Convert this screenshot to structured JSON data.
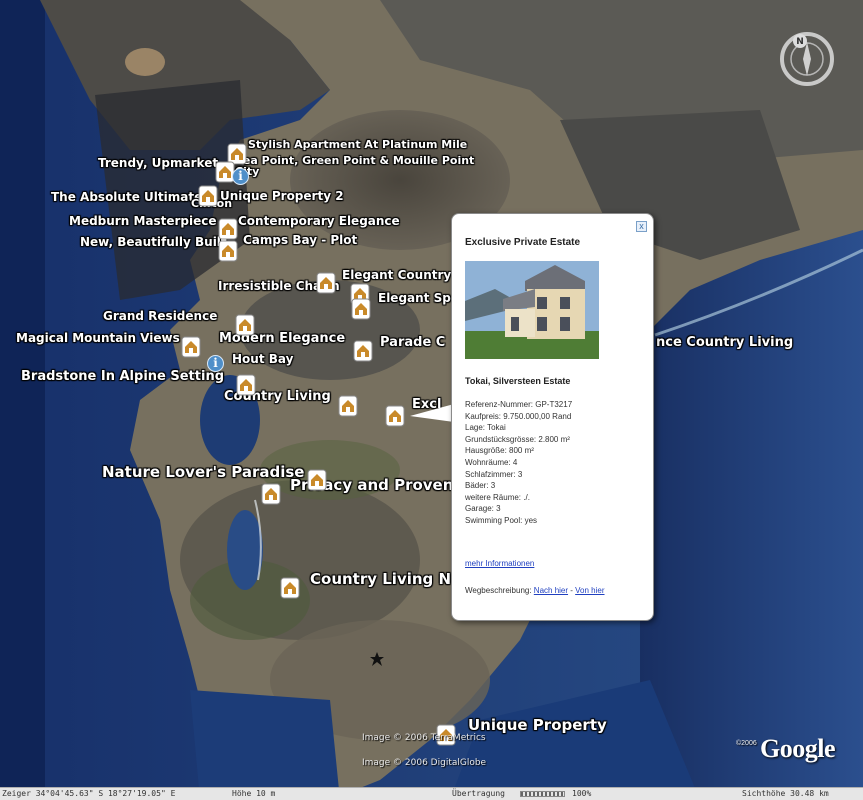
{
  "placemarks": [
    {
      "label": "Stylish Apartment At Platinum Mile"
    },
    {
      "label": "Trendy, Upmarket"
    },
    {
      "label": "Sea Point, Green Point & Mouille Point"
    },
    {
      "label": "City"
    },
    {
      "label": "The Absolute Ultimate"
    },
    {
      "label": "Unique Property 2"
    },
    {
      "label": "Clifton"
    },
    {
      "label": "Medburn Masterpiece"
    },
    {
      "label": "Contemporary Elegance"
    },
    {
      "label": "New, Beautifully Built"
    },
    {
      "label": "Camps Bay - Plot"
    },
    {
      "label": "Elegant Country"
    },
    {
      "label": "Irresistible Charm"
    },
    {
      "label": "Elegant Sp"
    },
    {
      "label": "Grand Residence"
    },
    {
      "label": "Magical Mountain Views"
    },
    {
      "label": "Modern Elegance"
    },
    {
      "label": "Parade C"
    },
    {
      "label": "nce Country Living"
    },
    {
      "label": "Hout Bay"
    },
    {
      "label": "Bradstone In Alpine Setting"
    },
    {
      "label": "Country Living"
    },
    {
      "label": "Excl"
    },
    {
      "label": "Nature Lover's Paradise"
    },
    {
      "label": "Privacy and Proven"
    },
    {
      "label": "Country Living N"
    },
    {
      "label": "Unique Property"
    }
  ],
  "popup": {
    "title": "Exclusive Private Estate",
    "close": "x",
    "subtitle": "Tokai, Silversteen Estate",
    "details": [
      "Referenz-Nummer: GP-T3217",
      "Kaufpreis: 9.750.000,00 Rand",
      "Lage: Tokai",
      "Grundstücksgrösse: 2.800 m²",
      "Hausgröße: 800 m²",
      "Wohnräume: 4",
      "Schlafzimmer: 3",
      "Bäder: 3",
      "weitere Räume: ./.",
      "Garage: 3",
      "Swimming Pool: yes"
    ],
    "more_link": "mehr Informationen",
    "directions_label": "Wegbeschreibung:",
    "directions_to": "Nach hier",
    "directions_sep": " - ",
    "directions_from": "Von hier"
  },
  "credits": {
    "terrametrics": "Image © 2006 TerraMetrics",
    "digitalglobe": "Image © 2006 DigitalGlobe",
    "google_year": "©2006",
    "google": "Google"
  },
  "statusbar": {
    "pointer": "Zeiger 34°04'45.63\" S   18°27'19.05\" E",
    "elevation": "Höhe  10 m",
    "streaming": "Übertragung",
    "streaming_pct": "100%",
    "eye_alt": "Sichthöhe   30.48 km"
  },
  "compass": {
    "north": "N"
  },
  "colors": {
    "ocean": "#1c3a73",
    "land": "#6f6a5c",
    "balloon_link": "#2040c0"
  }
}
